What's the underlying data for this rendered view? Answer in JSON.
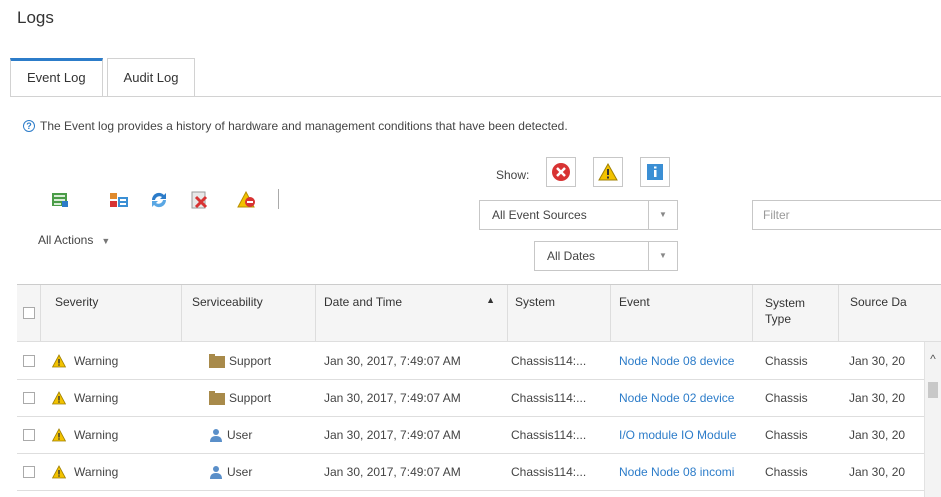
{
  "page": {
    "title": "Logs"
  },
  "tabs": [
    {
      "label": "Event Log",
      "active": true
    },
    {
      "label": "Audit Log",
      "active": false
    }
  ],
  "info_text": "The Event log provides a history of hardware and management conditions that have been detected.",
  "toolbar": {
    "icons": [
      "export-icon",
      "clear-logs-icon",
      "refresh-icon",
      "delete-event-icon",
      "exclude-event-icon"
    ],
    "all_actions": "All Actions"
  },
  "filters": {
    "show_label": "Show:",
    "show_buttons": [
      "critical-icon",
      "warning-icon",
      "informational-icon"
    ],
    "event_sources": "All Event Sources",
    "dates": "All Dates",
    "filter_placeholder": "Filter"
  },
  "table": {
    "columns": [
      "Severity",
      "Serviceability",
      "Date and Time",
      "System",
      "Event",
      "System Type",
      "Source Da"
    ],
    "sort_column": "Date and Time",
    "sort_direction": "ascending",
    "rows": [
      {
        "severity": "Warning",
        "serviceability": "Support",
        "serviceability_icon": "folder-icon",
        "date": "Jan 30, 2017, 7:49:07 AM",
        "system": "Chassis114:...",
        "event": "Node Node 08 device",
        "system_type": "Chassis",
        "source_date": "Jan 30, 20"
      },
      {
        "severity": "Warning",
        "serviceability": "Support",
        "serviceability_icon": "folder-icon",
        "date": "Jan 30, 2017, 7:49:07 AM",
        "system": "Chassis114:...",
        "event": "Node Node 02 device",
        "system_type": "Chassis",
        "source_date": "Jan 30, 20"
      },
      {
        "severity": "Warning",
        "serviceability": "User",
        "serviceability_icon": "user-icon",
        "date": "Jan 30, 2017, 7:49:07 AM",
        "system": "Chassis114:...",
        "event": "I/O module IO Module",
        "system_type": "Chassis",
        "source_date": "Jan 30, 20"
      },
      {
        "severity": "Warning",
        "serviceability": "User",
        "serviceability_icon": "user-icon",
        "date": "Jan 30, 2017, 7:49:07 AM",
        "system": "Chassis114:...",
        "event": "Node Node 08 incomi",
        "system_type": "Chassis",
        "source_date": "Jan 30, 20"
      }
    ]
  },
  "colors": {
    "accent": "#2c7cc9",
    "warning": "#f2c200",
    "critical": "#d83333",
    "info": "#3b8fd4",
    "folder": "#a88a4a"
  }
}
